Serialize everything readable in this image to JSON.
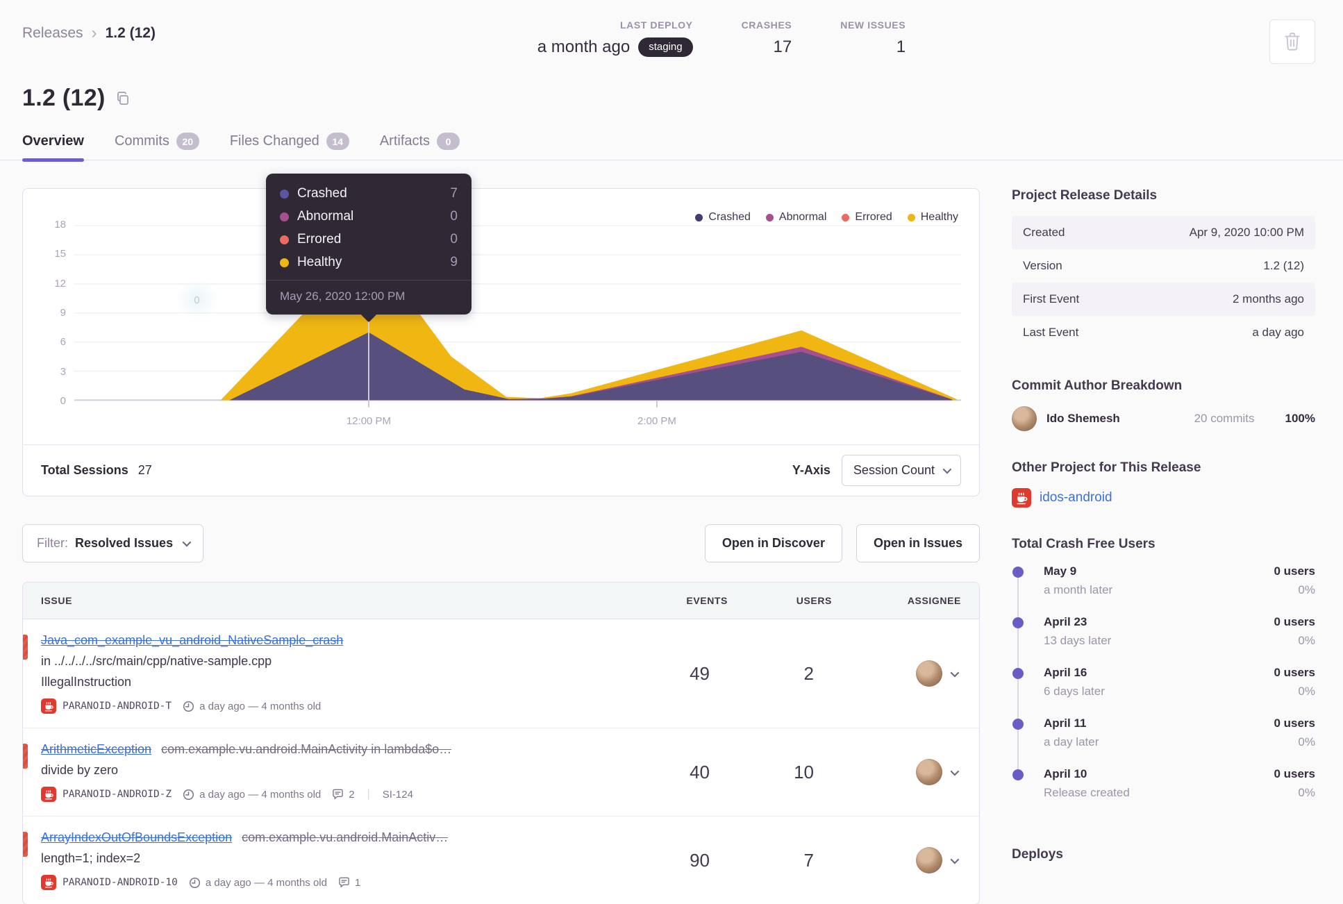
{
  "header": {
    "breadcrumb": {
      "parent": "Releases",
      "current": "1.2 (12)"
    },
    "stats": {
      "last_deploy": {
        "label": "LAST DEPLOY",
        "value": "a month ago",
        "badge": "staging"
      },
      "crashes": {
        "label": "CRASHES",
        "value": "17"
      },
      "new_issues": {
        "label": "NEW ISSUES",
        "value": "1"
      }
    }
  },
  "title": "1.2 (12)",
  "tabs": [
    {
      "label": "Overview"
    },
    {
      "label": "Commits",
      "badge": "20"
    },
    {
      "label": "Files Changed",
      "badge": "14"
    },
    {
      "label": "Artifacts",
      "badge": "0"
    }
  ],
  "chart_data": {
    "type": "area",
    "title": "Release sessions over time",
    "y_max": 18,
    "y_ticks": [
      "18",
      "15",
      "12",
      "9",
      "6",
      "3",
      "0"
    ],
    "x_ticks": [
      {
        "label": "12:00 PM",
        "xf": 0.332,
        "left": "33.2%"
      },
      {
        "label": "2:00 PM",
        "xf": 0.657,
        "left": "65.7%"
      }
    ],
    "legend": [
      {
        "label": "Crashed",
        "color": "#423d71"
      },
      {
        "label": "Abnormal",
        "color": "#a84f90"
      },
      {
        "label": "Errored",
        "color": "#ec6b5e"
      },
      {
        "label": "Healthy",
        "color": "#f0b712"
      }
    ],
    "watermark": "0",
    "pointer": {
      "xf": 0.332,
      "left": "33.2%"
    },
    "stack": [
      {
        "name": "total-sessions-top",
        "color": "#f0b712",
        "points": [
          [
            0.165,
            0
          ],
          [
            0.332,
            16
          ],
          [
            0.425,
            4.5
          ],
          [
            0.487,
            0.35
          ],
          [
            0.525,
            0.2
          ],
          [
            0.56,
            0.7
          ],
          [
            0.82,
            7.2
          ],
          [
            0.995,
            0.1
          ]
        ]
      },
      {
        "name": "crashed-plus-abnormal",
        "color": "#a84f90",
        "points": [
          [
            0.175,
            0
          ],
          [
            0.332,
            7
          ],
          [
            0.44,
            1.1
          ],
          [
            0.49,
            0.12
          ],
          [
            0.53,
            0.18
          ],
          [
            0.56,
            0.4
          ],
          [
            0.82,
            5.5
          ],
          [
            0.99,
            0.07
          ]
        ]
      },
      {
        "name": "crashed",
        "color": "#574f7d",
        "points": [
          [
            0.175,
            0
          ],
          [
            0.332,
            7
          ],
          [
            0.44,
            1.1
          ],
          [
            0.49,
            0.1
          ],
          [
            0.53,
            0.15
          ],
          [
            0.56,
            0.35
          ],
          [
            0.82,
            5
          ],
          [
            0.99,
            0.05
          ]
        ]
      }
    ],
    "tooltip": {
      "left": "33.2%",
      "date": "May 26, 2020 12:00 PM",
      "rows": [
        {
          "label": "Crashed",
          "value": "7",
          "color": "#5c55a2"
        },
        {
          "label": "Abnormal",
          "value": "0",
          "color": "#a84f90"
        },
        {
          "label": "Errored",
          "value": "0",
          "color": "#ec6b5e"
        },
        {
          "label": "Healthy",
          "value": "9",
          "color": "#f0b712"
        }
      ]
    }
  },
  "sessions": {
    "label": "Total Sessions",
    "value": "27",
    "yaxis_label": "Y-Axis",
    "yaxis_value": "Session Count"
  },
  "filter": {
    "label": "Filter:",
    "value": "Resolved Issues"
  },
  "actions": {
    "discover": "Open in Discover",
    "issues": "Open in Issues"
  },
  "issues": {
    "columns": [
      "ISSUE",
      "EVENTS",
      "USERS",
      "ASSIGNEE"
    ],
    "rows": [
      {
        "title": "Java_com_example_vu_android_NativeSample_crash",
        "location": "in ../../../../src/main/cpp/native-sample.cpp",
        "subtitle": "IllegalInstruction",
        "project": "PARANOID-ANDROID-T",
        "age": "a day ago — 4 months old",
        "events": "49",
        "users": "2"
      },
      {
        "title": "ArithmeticException",
        "culprit": "com.example.vu.android.MainActivity in lambda$o…",
        "subtitle": "divide by zero",
        "project": "PARANOID-ANDROID-Z",
        "age": "a day ago — 4 months old",
        "comments": "2",
        "short_id": "SI-124",
        "events": "40",
        "users": "10"
      },
      {
        "title": "ArrayIndexOutOfBoundsException",
        "culprit": "com.example.vu.android.MainActiv…",
        "subtitle": "length=1; index=2",
        "project": "PARANOID-ANDROID-10",
        "age": "a day ago — 4 months old",
        "comments": "1",
        "events": "90",
        "users": "7"
      }
    ]
  },
  "sidebar": {
    "details": {
      "title": "Project Release Details",
      "rows": [
        {
          "label": "Created",
          "value": "Apr 9, 2020 10:00 PM"
        },
        {
          "label": "Version",
          "value": "1.2 (12)"
        },
        {
          "label": "First Event",
          "value": "2 months ago"
        },
        {
          "label": "Last Event",
          "value": "a day ago"
        }
      ]
    },
    "authors": {
      "title": "Commit Author Breakdown",
      "name": "Ido Shemesh",
      "commits": "20 commits",
      "percent": "100%"
    },
    "other_project": {
      "title": "Other Project for This Release",
      "project": "idos-android"
    },
    "crashfree": {
      "title": "Total Crash Free Users",
      "items": [
        {
          "date": "May 9",
          "sub": "a month later",
          "users": "0 users",
          "pct": "0%"
        },
        {
          "date": "April 23",
          "sub": "13 days later",
          "users": "0 users",
          "pct": "0%"
        },
        {
          "date": "April 16",
          "sub": "6 days later",
          "users": "0 users",
          "pct": "0%"
        },
        {
          "date": "April 11",
          "sub": "a day later",
          "users": "0 users",
          "pct": "0%"
        },
        {
          "date": "April 10",
          "sub": "Release created",
          "users": "0 users",
          "pct": "0%"
        }
      ]
    },
    "deploys": {
      "title": "Deploys"
    }
  },
  "colors": {
    "accent": "#6c5fc7",
    "crashed": "#574f7d",
    "abnormal": "#a84f90",
    "errored": "#ec6b5e",
    "healthy": "#f0b712",
    "link": "#3a70d9",
    "marker_red": "#e8594a",
    "badge_dark": "#2f2936"
  }
}
